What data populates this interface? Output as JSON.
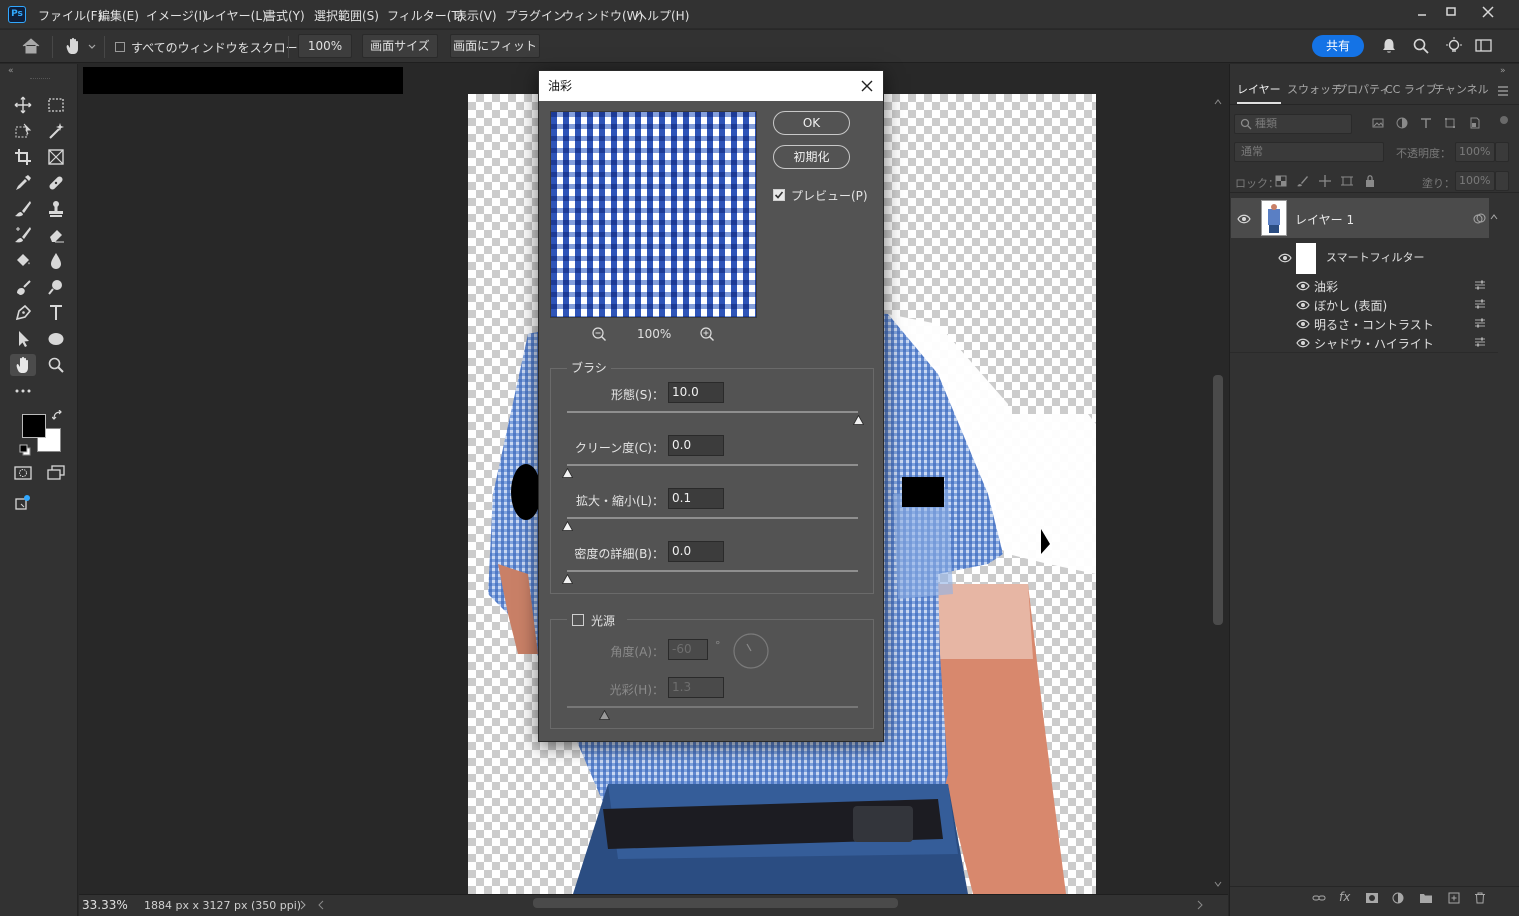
{
  "app": {
    "logo": "Ps"
  },
  "menubar": {
    "items": [
      "ファイル(F)",
      "編集(E)",
      "イメージ(I)",
      "レイヤー(L)",
      "書式(Y)",
      "選択範囲(S)",
      "フィルター(T)",
      "表示(V)",
      "プラグイン",
      "ウィンドウ(W)",
      "ヘルプ(H)"
    ]
  },
  "options": {
    "scroll_all_label": "すべてのウィンドウをスクロール",
    "zoom_value": "100%",
    "fit_screen_label": "画面サイズ",
    "fill_screen_label": "画面にフィット",
    "share_label": "共有"
  },
  "status": {
    "zoom": "33.33%",
    "doc_info": "1884 px x 3127 px (350 ppi)"
  },
  "layers_panel": {
    "tabs": [
      "レイヤー",
      "スウォッチ",
      "プロパティ",
      "CC ライブ",
      "チャンネル"
    ],
    "filter_placeholder": "種類",
    "blend_mode": "通常",
    "opacity_label": "不透明度：",
    "opacity_value": "100%",
    "lock_label": "ロック：",
    "fill_label": "塗り：",
    "fill_value": "100%",
    "layer_name": "レイヤー 1",
    "smart_filters_label": "スマートフィルター",
    "filters": [
      "油彩",
      "ぼかし (表面)",
      "明るさ・コントラスト",
      "シャドウ・ハイライト"
    ]
  },
  "dialog": {
    "title": "油彩",
    "ok_label": "OK",
    "reset_label": "初期化",
    "preview_label": "プレビュー(P)",
    "preview_checked": true,
    "preview_zoom": "100%",
    "brush_group_label": "ブラシ",
    "fields": [
      {
        "label": "形態(S)：",
        "value": "10.0",
        "slider_fraction": 1.0
      },
      {
        "label": "クリーン度(C)：",
        "value": "0.0",
        "slider_fraction": 0.0
      },
      {
        "label": "拡大・縮小(L)：",
        "value": "0.1",
        "slider_fraction": 0.0
      },
      {
        "label": "密度の詳細(B)：",
        "value": "0.0",
        "slider_fraction": 0.0
      }
    ],
    "light_group_label": "光源",
    "light_checked": false,
    "angle_label": "角度(A)：",
    "angle_value": "-60",
    "angle_unit": "°",
    "shine_label": "光彩(H)：",
    "shine_value": "1.3",
    "shine_slider_fraction": 0.13
  },
  "colors": {
    "accent": "#1473e6",
    "panel": "#323232",
    "dialog": "#535353"
  }
}
